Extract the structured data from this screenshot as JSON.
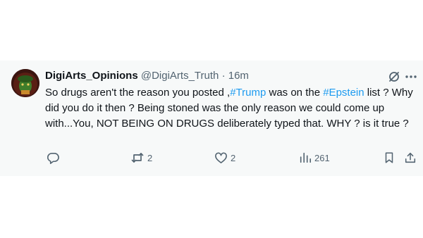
{
  "tweet": {
    "name": "DigiArts_Opinions",
    "handle": "@DigiArts_Truth",
    "separator": "·",
    "time": "16m",
    "text_parts": [
      "So drugs aren't the reason you posted ,",
      "#Trump",
      " was on the ",
      "#Epstein",
      " list ? Why did you do it then ? Being stoned was the only reason we could come up with...You, NOT BEING ON DRUGS deliberately typed that. WHY ? is it true ?"
    ],
    "hashtag_color": "#1d9bf0"
  },
  "actions": {
    "reply_count": "",
    "retweet_count": "2",
    "like_count": "2",
    "views_count": "261"
  },
  "icons": {
    "reply": "reply-icon",
    "retweet": "retweet-icon",
    "like": "heart-icon",
    "views": "views-icon",
    "bookmark": "bookmark-icon",
    "share": "share-icon",
    "grok": "grok-icon",
    "more": "more-icon"
  },
  "colors": {
    "text": "#0f1419",
    "secondary": "#536471",
    "accent": "#1d9bf0",
    "card_bg": "#f7f9f9"
  }
}
